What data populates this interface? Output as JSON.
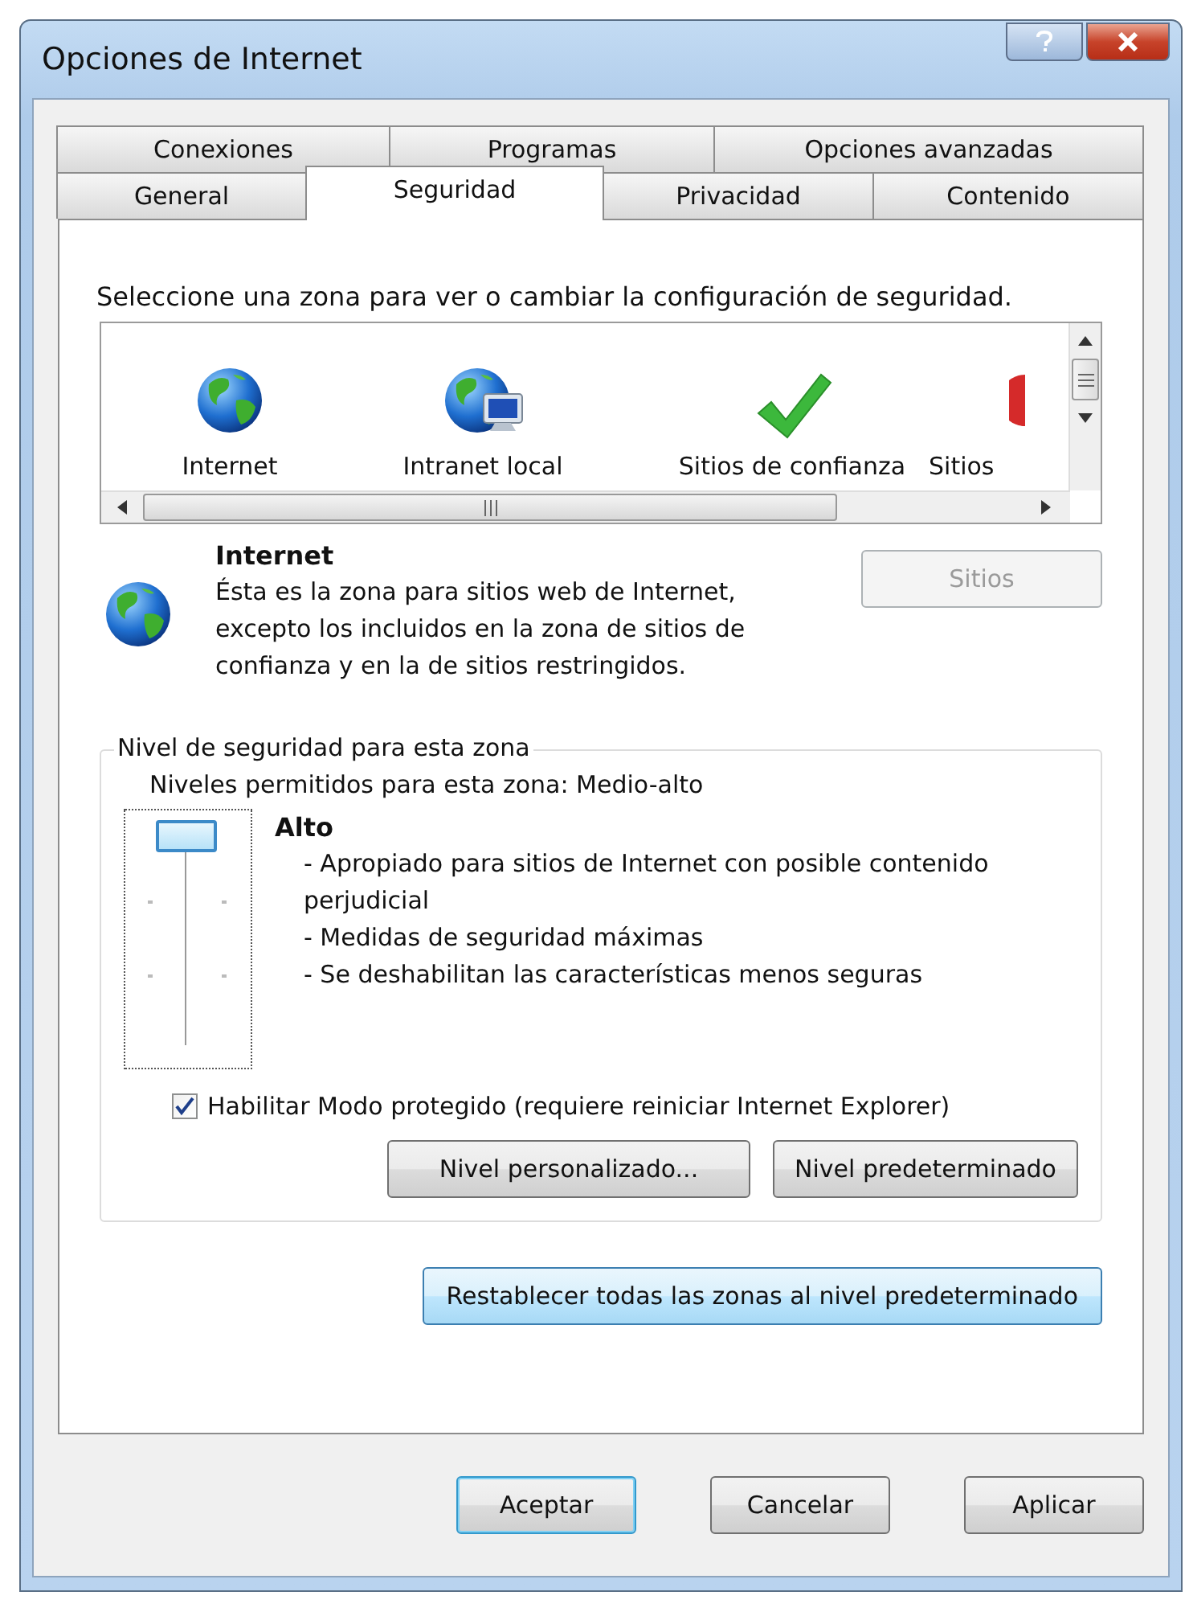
{
  "window": {
    "title": "Opciones de Internet"
  },
  "tab_rows": [
    {
      "tabs": [
        {
          "label": "Conexiones",
          "selected": false
        },
        {
          "label": "Programas",
          "selected": false
        },
        {
          "label": "Opciones avanzadas",
          "selected": false
        }
      ]
    },
    {
      "tabs": [
        {
          "label": "General",
          "selected": false
        },
        {
          "label": "Seguridad",
          "selected": true
        },
        {
          "label": "Privacidad",
          "selected": false
        },
        {
          "label": "Contenido",
          "selected": false
        }
      ]
    }
  ],
  "zone_prompt": "Seleccione una zona para ver o cambiar la configuración de seguridad.",
  "zones": [
    {
      "label": "Internet",
      "kind": "globe"
    },
    {
      "label": "Intranet local",
      "kind": "intranet"
    },
    {
      "label": "Sitios de confianza",
      "kind": "check"
    },
    {
      "label": "Sitios",
      "kind": "restricted"
    }
  ],
  "zone_info": {
    "title": "Internet",
    "description": "Ésta es la zona para sitios web de Internet, excepto los incluidos en la zona de sitios de confianza y en la de sitios restringidos.",
    "sites_button": {
      "label": "Sitios",
      "disabled": true
    }
  },
  "security_level": {
    "legend": "Nivel de seguridad para esta zona",
    "allowed": "Niveles permitidos para esta zona: Medio-alto",
    "slider": {
      "level": 1
    },
    "level_name": "Alto",
    "details": [
      "- Apropiado para sitios de Internet con posible contenido perjudicial",
      "- Medidas de seguridad máximas",
      "- Se deshabilitan las características menos seguras"
    ],
    "protected_mode": {
      "label": "Habilitar Modo protegido (requiere reiniciar Internet Explorer)",
      "checked": true
    },
    "buttons": [
      {
        "label": "Nivel personalizado..."
      },
      {
        "label": "Nivel predeterminado"
      }
    ]
  },
  "reset_button": {
    "label": "Restablecer todas las zonas al nivel predeterminado",
    "hover": true
  },
  "dialog_buttons": [
    {
      "label": "Aceptar",
      "default": true
    },
    {
      "label": "Cancelar",
      "default": false
    },
    {
      "label": "Aplicar",
      "default": false
    }
  ]
}
